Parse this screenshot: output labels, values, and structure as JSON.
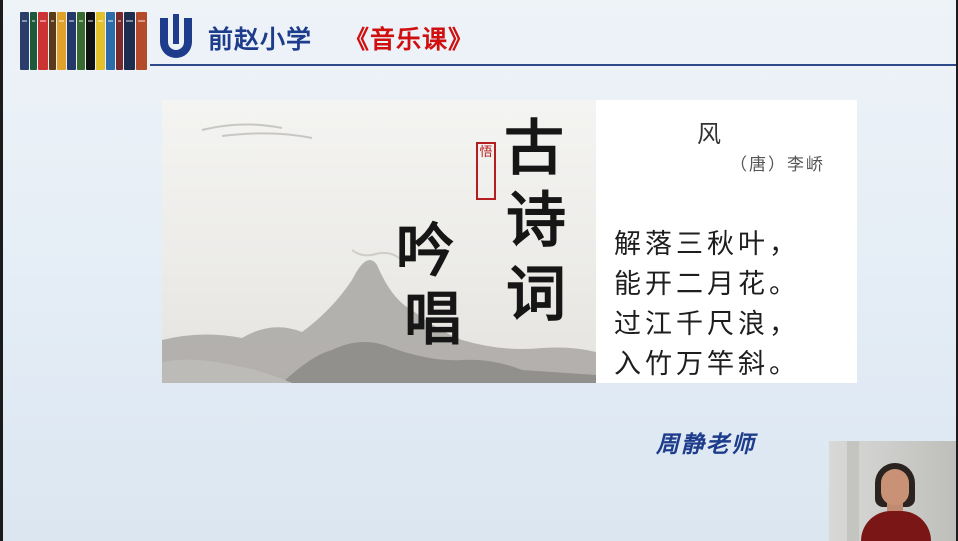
{
  "header": {
    "school_name": "前赵小学",
    "course_name": "《音乐课》",
    "accent_color": "#1e3c8c",
    "course_color": "#d01010",
    "logo_icon": "school-logo-icon",
    "books_icon": "bookshelf-icon"
  },
  "poster": {
    "calligraphy": [
      "古",
      "诗",
      "词",
      "吟",
      "唱"
    ],
    "seal_text": "悟",
    "poem": {
      "title": "风",
      "author": "（唐）李峤",
      "lines": [
        "解落三秋叶，",
        "能开二月花。",
        "过江千尺浪，",
        "入竹万竿斜。"
      ]
    }
  },
  "teacher": "周静老师",
  "webcam": {
    "icon": "presenter-video-icon"
  }
}
